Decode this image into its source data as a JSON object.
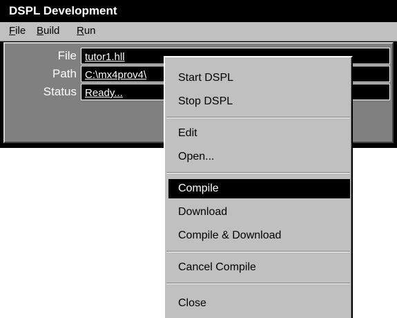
{
  "window": {
    "title": "DSPL Development"
  },
  "menubar": {
    "items": [
      {
        "accel": "F",
        "rest": "ile"
      },
      {
        "accel": "B",
        "rest": "uild"
      },
      {
        "accel": "R",
        "rest": "un"
      }
    ]
  },
  "fields": {
    "file": {
      "label": "File",
      "value": "tutor1.hll"
    },
    "path": {
      "label": "Path",
      "value": "C:\\mx4prov4\\"
    },
    "status": {
      "label": "Status",
      "value": "Ready..."
    }
  },
  "popup_menu": {
    "start_dspl": "Start DSPL",
    "stop_dspl": "Stop DSPL",
    "edit": "Edit",
    "open": "Open...",
    "compile": "Compile",
    "download": "Download",
    "compile_download": "Compile & Download",
    "cancel_compile": "Cancel Compile",
    "close": "Close",
    "selected_item": "Compile"
  },
  "colors": {
    "title_bg": "#000000",
    "face": "#c0c0c0",
    "panel": "#808080",
    "highlight": "#000000"
  }
}
